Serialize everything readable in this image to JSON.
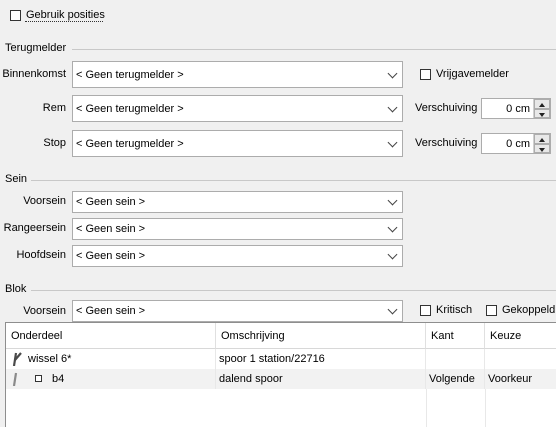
{
  "use_positions": {
    "label": "Gebruik posities",
    "checked": false
  },
  "terugmelder": {
    "section_title": "Terugmelder",
    "binnenkomst": {
      "label": "Binnenkomst",
      "value": "< Geen terugmelder >"
    },
    "vrijgave": {
      "label": "Vrijgavemelder",
      "checked": false
    },
    "rem": {
      "label": "Rem",
      "value": "< Geen terugmelder >",
      "shift_label": "Verschuiving",
      "shift_value": "0 cm"
    },
    "stop": {
      "label": "Stop",
      "value": "< Geen terugmelder >",
      "shift_label": "Verschuiving",
      "shift_value": "0 cm"
    }
  },
  "sein": {
    "section_title": "Sein",
    "voorsein": {
      "label": "Voorsein",
      "value": "< Geen sein >"
    },
    "rangeersein": {
      "label": "Rangeersein",
      "value": "< Geen sein >"
    },
    "hoofdsein": {
      "label": "Hoofdsein",
      "value": "< Geen sein >"
    }
  },
  "blok": {
    "section_title": "Blok",
    "voorsein": {
      "label": "Voorsein",
      "value": "< Geen sein >"
    },
    "kritisch": {
      "label": "Kritisch",
      "checked": false
    },
    "gekoppeld": {
      "label": "Gekoppeld",
      "checked": false
    }
  },
  "table": {
    "columns": [
      "Onderdeel",
      "Omschrijving",
      "Kant",
      "Keuze"
    ],
    "rows": [
      {
        "onderdeel": "wissel 6*",
        "icon": "switch-icon",
        "omschrijving": "spoor 1 station/22716",
        "kant": "",
        "keuze": ""
      },
      {
        "onderdeel": "b4",
        "icon": "block-icon",
        "omschrijving": "dalend spoor",
        "kant": "Volgende",
        "keuze": "Voorkeur"
      }
    ]
  },
  "colors": {
    "window_bg": "#f0f0f0",
    "border": "#acacac",
    "row_alt": "#f2f2f2",
    "switch_icon": "#4a4a4a",
    "switch_icon_light": "#8a8a8a"
  }
}
